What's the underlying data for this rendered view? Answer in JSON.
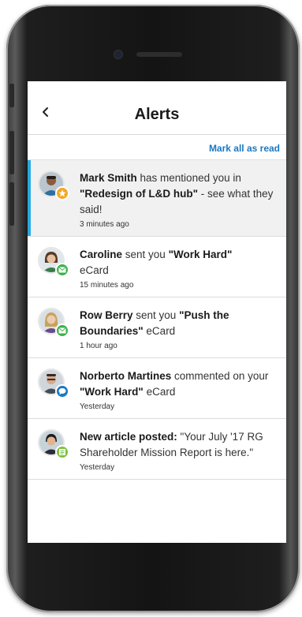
{
  "header": {
    "title": "Alerts"
  },
  "actions": {
    "mark_all": "Mark all as read"
  },
  "alerts": [
    {
      "name": "Mark Smith",
      "text1": " has mentioned you in ",
      "highlight": "\"Redesign of L&D hub\"",
      "text2": " - see what they said!",
      "time": "3 minutes ago",
      "badge_icon": "star-icon",
      "badge_color": "#f5a623",
      "unread": true
    },
    {
      "name": "Caroline",
      "text1": " sent you ",
      "highlight": "\"Work Hard\"",
      "text2": " eCard",
      "time": "15 minutes ago",
      "badge_icon": "envelope-icon",
      "badge_color": "#3cb34a",
      "unread": false
    },
    {
      "name": "Row Berry",
      "text1": " sent you ",
      "highlight": "\"Push the Boundaries\"",
      "text2": " eCard",
      "time": "1 hour ago",
      "badge_icon": "envelope-icon",
      "badge_color": "#3cb34a",
      "unread": false
    },
    {
      "name": "Norberto Martines",
      "text1": " commented on your ",
      "highlight": "\"Work Hard\"",
      "text2": " eCard",
      "time": "Yesterday",
      "badge_icon": "speech-bubble-icon",
      "badge_color": "#1a78c2",
      "unread": false
    },
    {
      "name": "New article posted:",
      "text1": " \"Your July '17 RG Shareholder Mission Report is here.\"",
      "highlight": "",
      "text2": "",
      "time": "Yesterday",
      "badge_icon": "article-icon",
      "badge_color": "#7cc142",
      "unread": false
    }
  ]
}
